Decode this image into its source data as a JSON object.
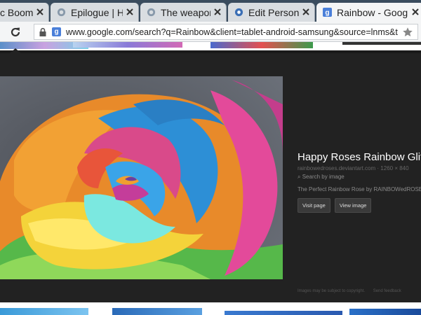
{
  "browser": {
    "tabs": [
      {
        "title": "c Boom",
        "active": false,
        "icon": "page-icon"
      },
      {
        "title": "Epilogue | Ha",
        "active": false,
        "icon": "page-icon"
      },
      {
        "title": "The weapon",
        "active": false,
        "icon": "page-icon"
      },
      {
        "title": "Edit Personal",
        "active": false,
        "icon": "page-icon"
      },
      {
        "title": "Rainbow - Google",
        "active": true,
        "icon": "google-icon"
      }
    ],
    "url": "www.google.com/search?q=Rainbow&client=tablet-android-samsung&source=lnms&tbm=isch&sa=X&ei=I",
    "google_favicon": "g"
  },
  "preview": {
    "title": "Happy Roses Rainbow Glitter",
    "source": "rainbowedroses.deviantart.com",
    "dimensions": "1260 × 840",
    "search_by_image": "Search by image",
    "description": "The Perfect Rainbow Rose by RAINBOWedROSES",
    "visit_page": "Visit page",
    "view_image": "View image",
    "footer_note": "Images may be subject to copyright.",
    "feedback": "Send feedback"
  },
  "colors": {
    "tabstrip": "#3a4c5e",
    "panel": "#222222",
    "accent": "#4a7fd9"
  }
}
